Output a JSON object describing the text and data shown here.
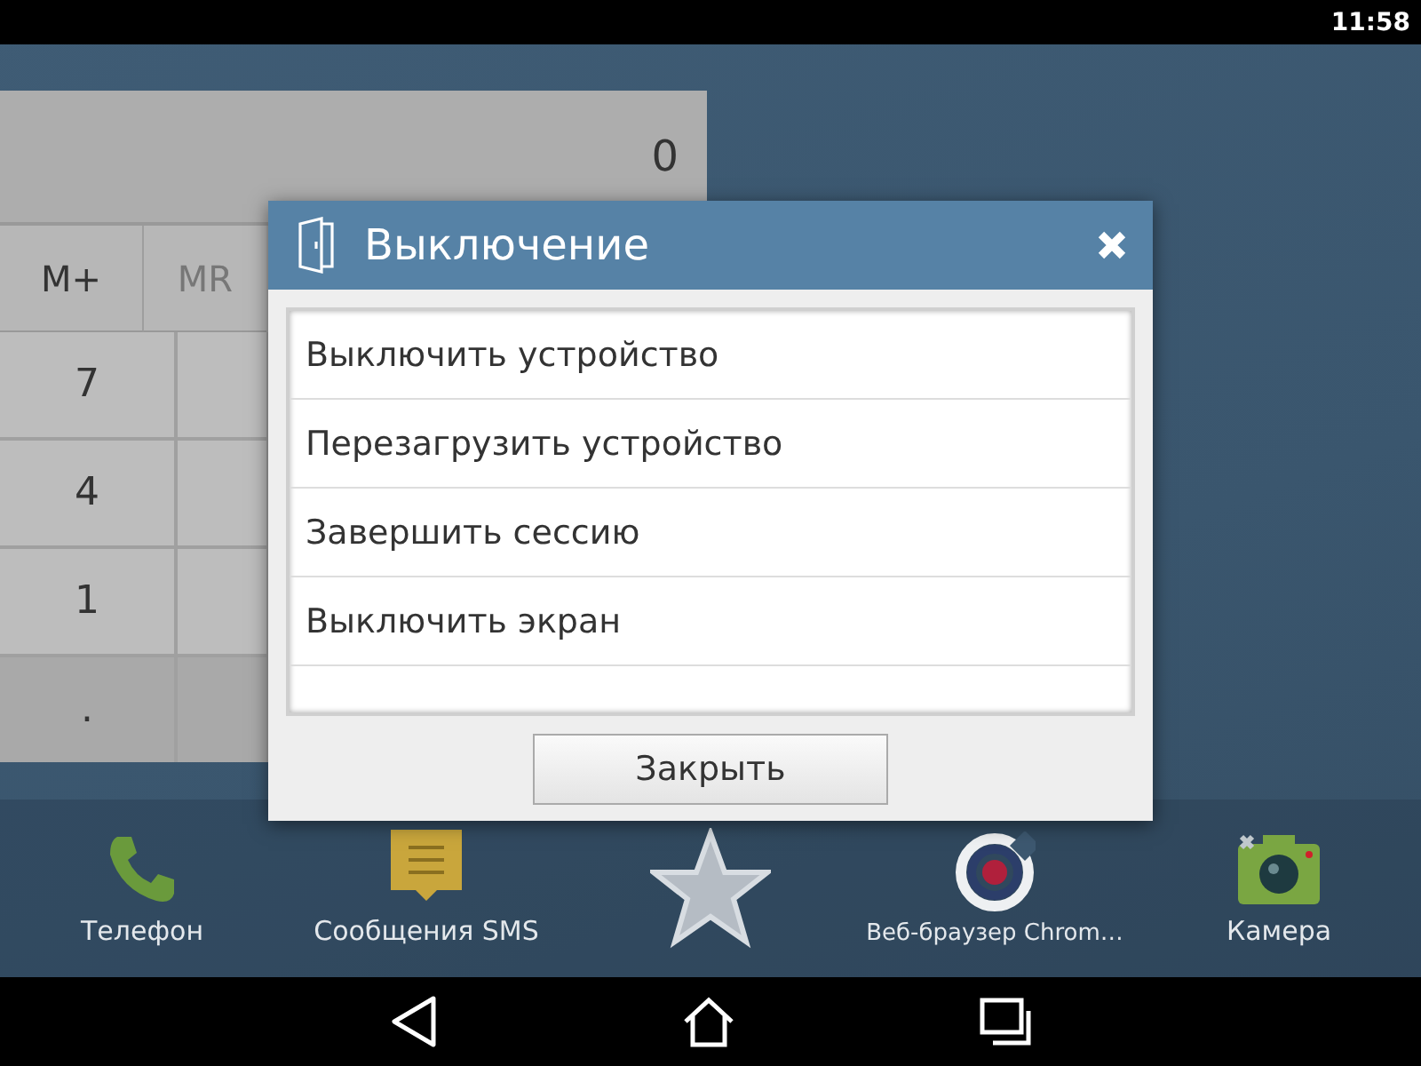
{
  "status_bar": {
    "time": "11:58"
  },
  "calculator": {
    "display": "0",
    "memory_keys": [
      {
        "label": "M+",
        "disabled": false
      },
      {
        "label": "MR",
        "disabled": true
      }
    ],
    "digit_keys": [
      "7",
      "4",
      "1",
      "."
    ]
  },
  "dialog": {
    "title": "Выключение",
    "items": [
      "Выключить устройство",
      "Перезагрузить устройство",
      "Завершить сессию",
      "Выключить экран"
    ],
    "button": "Закрыть"
  },
  "dock": [
    {
      "kind": "phone",
      "label": "Телефон"
    },
    {
      "kind": "sms",
      "label": "Сообщения SMS"
    },
    {
      "kind": "star"
    },
    {
      "kind": "browser",
      "label": "Веб-браузер Chrom…"
    },
    {
      "kind": "camera",
      "label": "Камера"
    }
  ]
}
